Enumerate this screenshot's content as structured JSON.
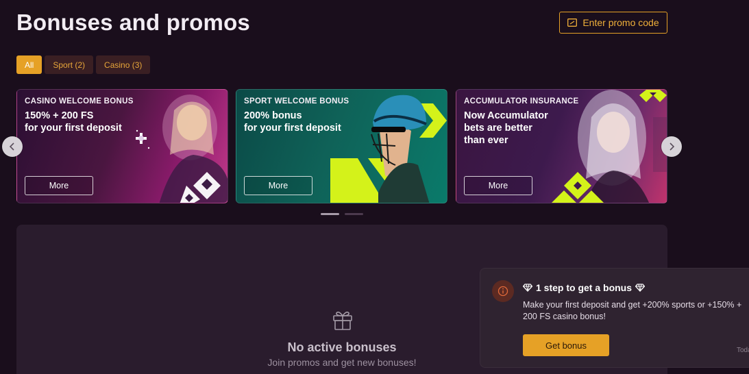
{
  "page": {
    "title": "Bonuses and promos",
    "promo_button": {
      "label": "Enter promo code",
      "icon": "ticket-icon"
    }
  },
  "filters": [
    {
      "label": "All",
      "active": true
    },
    {
      "label": "Sport (2)",
      "active": false
    },
    {
      "label": "Casino (3)",
      "active": false
    }
  ],
  "cards": [
    {
      "tag": "CASINO WELCOME BONUS",
      "line1": "150% + 200 FS",
      "line2": "for your first deposit",
      "line3": "",
      "button": "More"
    },
    {
      "tag": "SPORT WELCOME BONUS",
      "line1": "200% bonus",
      "line2": "for your first deposit",
      "line3": "",
      "button": "More"
    },
    {
      "tag": "ACCUMULATOR INSURANCE",
      "line1": "Now Accumulator",
      "line2": "bets are better",
      "line3": "than ever",
      "button": "More"
    }
  ],
  "carousel": {
    "pages": 2,
    "current_page": 1,
    "prev_icon": "chevron-left-icon",
    "next_icon": "chevron-right-icon"
  },
  "empty_state": {
    "icon": "gift-icon",
    "title": "No active bonuses",
    "subtitle": "Join promos and get new bonuses!"
  },
  "toast": {
    "icon": "info-icon",
    "title": "1 step to get a bonus",
    "text": "Make your first deposit and get +200% sports or +150% + 200 FS casino bonus!",
    "button": "Get bonus",
    "time": "Toda"
  },
  "colors": {
    "background": "#1a0e1c",
    "accent": "#e6a126",
    "panel": "#2a1c2d",
    "lime": "#d4f21a"
  }
}
